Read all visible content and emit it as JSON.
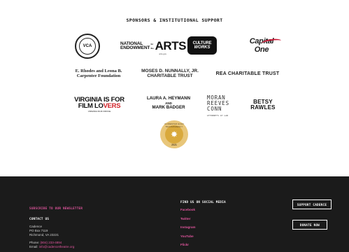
{
  "sponsors": {
    "title": "SPONSORS & INSTITUTIONAL SUPPORT",
    "vca": {
      "name": "VCA"
    },
    "nea": {
      "line1": "NATIONAL",
      "line2": "ENDOWMENT",
      "for_the": "for the",
      "big": "ARTS",
      "sub": "arts.gov"
    },
    "culture_works": {
      "line1": "CULTURE",
      "line2": "WORKS"
    },
    "capital_one": {
      "text": "Capital One"
    },
    "rhodes": {
      "line1": "E. Rhodes and Leona B.",
      "line2": "Carpenter Foundation"
    },
    "nunnally": {
      "line1": "MOSES D. NUNNALLY, JR.",
      "line2": "CHARITABLE TRUST"
    },
    "rea": {
      "text": "REA CHARITABLE TRUST"
    },
    "virginia": {
      "line1": "VIRGINIA IS FOR",
      "line2a": "FILM LO",
      "line2b": "VERS",
      "line3": "VIRGINIA FILM OFFICE"
    },
    "heymann": {
      "line1": "LAURA A. HEYMANN",
      "line2": "AND",
      "line3": "MARK BADGER"
    },
    "moran": {
      "l1": "MORAN",
      "l2": "REEVES",
      "l3": "CONN",
      "tiny": "ATTORNEYS AT LAW"
    },
    "betsy": {
      "line1": "BETSY",
      "line2": "RAWLES"
    },
    "seal": {
      "arc": "GUIDESTAR GOLD TRANSPARENCY",
      "year": "2021"
    }
  },
  "footer": {
    "newsletter_kicker": "SUBSCRIBE TO OUR NEWSLETTER",
    "contact_heading": "CONTACT US",
    "address": [
      "Cadence",
      "PO Box 7119",
      "Richmond, VA 23221"
    ],
    "phone_label": "Phone:",
    "phone": "(804) 233-4894",
    "email_label": "Email:",
    "email": "info@cadencetheatre.org",
    "social_heading": "FIND US ON SOCIAL MEDIA",
    "social": [
      "Facebook",
      "Twitter",
      "Instagram",
      "YouTube",
      "Flickr"
    ],
    "support_btn": "SUPPORT CADENCE",
    "donate_btn": "DONATE NOW"
  },
  "colors": {
    "accent": "#e0559d",
    "footer_bg": "#1b1b1b",
    "gold": "#d9a93c"
  }
}
